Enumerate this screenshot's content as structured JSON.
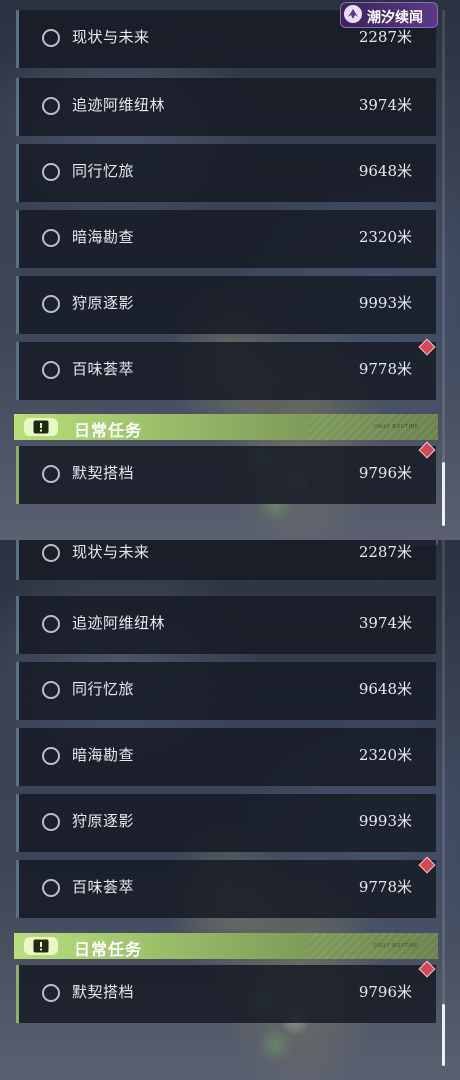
{
  "event_badge": {
    "label": "潮汐续闻",
    "icon": "tide-logo-icon"
  },
  "quests": [
    {
      "name": "现状与未来",
      "distance": "2287米",
      "has_marker": false
    },
    {
      "name": "追迹阿维纽林",
      "distance": "3974米",
      "has_marker": false
    },
    {
      "name": "同行忆旅",
      "distance": "9648米",
      "has_marker": false
    },
    {
      "name": "暗海勘查",
      "distance": "2320米",
      "has_marker": false
    },
    {
      "name": "狩原逐影",
      "distance": "9993米",
      "has_marker": false
    },
    {
      "name": "百味荟萃",
      "distance": "9778米",
      "has_marker": true
    }
  ],
  "daily_section": {
    "title": "日常任务",
    "icon": "alert-icon",
    "tag": "DAILY ROUTINE"
  },
  "daily_quests": [
    {
      "name": "默契搭档",
      "distance": "9796米",
      "has_marker": true
    }
  ],
  "colors": {
    "section_green": "#b8df7a",
    "badge_purple": "#5a3a86",
    "marker_red": "#d24a58",
    "item_bg": "#161b25"
  }
}
